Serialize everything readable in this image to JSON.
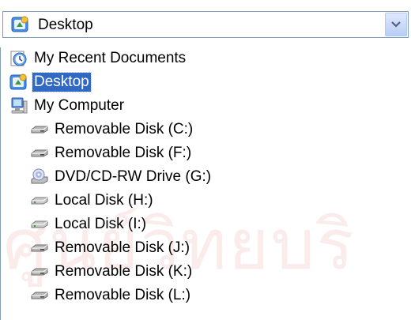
{
  "watermark": "ศูนย์วิทยบริ",
  "combo": {
    "selected": "Desktop",
    "icon": "desktop-icon"
  },
  "items": [
    {
      "label": "My Recent Documents",
      "icon": "recent-documents-icon",
      "level": 0,
      "selected": false
    },
    {
      "label": "Desktop",
      "icon": "desktop-icon",
      "level": 0,
      "selected": true
    },
    {
      "label": "My Computer",
      "icon": "my-computer-icon",
      "level": 1,
      "selected": false
    },
    {
      "label": "Removable Disk (C:)",
      "icon": "removable-disk-icon",
      "level": 2,
      "selected": false
    },
    {
      "label": "Removable Disk (F:)",
      "icon": "removable-disk-icon",
      "level": 2,
      "selected": false
    },
    {
      "label": "DVD/CD-RW Drive (G:)",
      "icon": "dvd-drive-icon",
      "level": 2,
      "selected": false
    },
    {
      "label": "Local Disk  (H:)",
      "icon": "local-disk-icon",
      "level": 2,
      "selected": false
    },
    {
      "label": "Local Disk (I:)",
      "icon": "local-disk-icon",
      "level": 2,
      "selected": false
    },
    {
      "label": "Removable Disk (J:)",
      "icon": "removable-disk-icon",
      "level": 2,
      "selected": false
    },
    {
      "label": "Removable Disk (K:)",
      "icon": "removable-disk-icon",
      "level": 2,
      "selected": false
    },
    {
      "label": "Removable Disk (L:)",
      "icon": "removable-disk-icon",
      "level": 2,
      "selected": false
    }
  ],
  "colors": {
    "selection": "#316ac5",
    "border": "#7f9db9",
    "watermark": "#fbecec"
  }
}
